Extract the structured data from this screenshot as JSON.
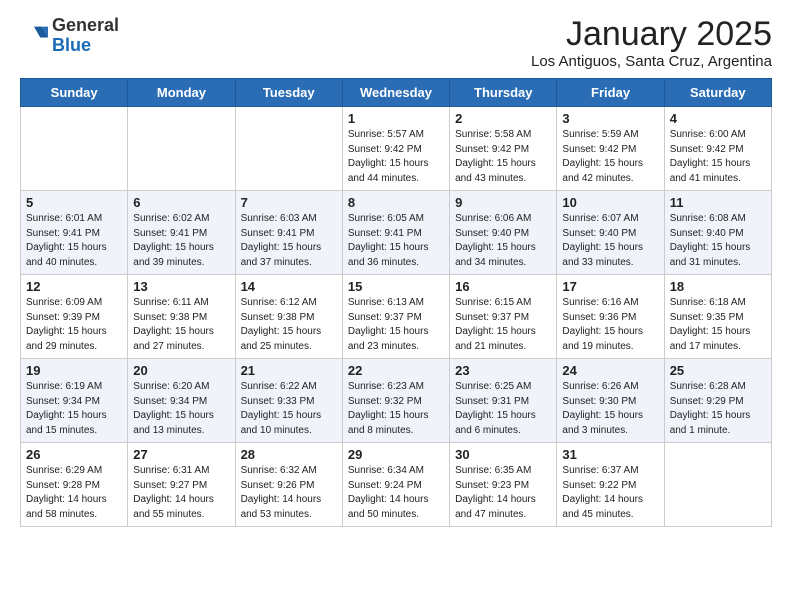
{
  "header": {
    "logo_general": "General",
    "logo_blue": "Blue",
    "month": "January 2025",
    "location": "Los Antiguos, Santa Cruz, Argentina"
  },
  "days_of_week": [
    "Sunday",
    "Monday",
    "Tuesday",
    "Wednesday",
    "Thursday",
    "Friday",
    "Saturday"
  ],
  "weeks": [
    [
      {
        "day": "",
        "info": ""
      },
      {
        "day": "",
        "info": ""
      },
      {
        "day": "",
        "info": ""
      },
      {
        "day": "1",
        "info": "Sunrise: 5:57 AM\nSunset: 9:42 PM\nDaylight: 15 hours\nand 44 minutes."
      },
      {
        "day": "2",
        "info": "Sunrise: 5:58 AM\nSunset: 9:42 PM\nDaylight: 15 hours\nand 43 minutes."
      },
      {
        "day": "3",
        "info": "Sunrise: 5:59 AM\nSunset: 9:42 PM\nDaylight: 15 hours\nand 42 minutes."
      },
      {
        "day": "4",
        "info": "Sunrise: 6:00 AM\nSunset: 9:42 PM\nDaylight: 15 hours\nand 41 minutes."
      }
    ],
    [
      {
        "day": "5",
        "info": "Sunrise: 6:01 AM\nSunset: 9:41 PM\nDaylight: 15 hours\nand 40 minutes."
      },
      {
        "day": "6",
        "info": "Sunrise: 6:02 AM\nSunset: 9:41 PM\nDaylight: 15 hours\nand 39 minutes."
      },
      {
        "day": "7",
        "info": "Sunrise: 6:03 AM\nSunset: 9:41 PM\nDaylight: 15 hours\nand 37 minutes."
      },
      {
        "day": "8",
        "info": "Sunrise: 6:05 AM\nSunset: 9:41 PM\nDaylight: 15 hours\nand 36 minutes."
      },
      {
        "day": "9",
        "info": "Sunrise: 6:06 AM\nSunset: 9:40 PM\nDaylight: 15 hours\nand 34 minutes."
      },
      {
        "day": "10",
        "info": "Sunrise: 6:07 AM\nSunset: 9:40 PM\nDaylight: 15 hours\nand 33 minutes."
      },
      {
        "day": "11",
        "info": "Sunrise: 6:08 AM\nSunset: 9:40 PM\nDaylight: 15 hours\nand 31 minutes."
      }
    ],
    [
      {
        "day": "12",
        "info": "Sunrise: 6:09 AM\nSunset: 9:39 PM\nDaylight: 15 hours\nand 29 minutes."
      },
      {
        "day": "13",
        "info": "Sunrise: 6:11 AM\nSunset: 9:38 PM\nDaylight: 15 hours\nand 27 minutes."
      },
      {
        "day": "14",
        "info": "Sunrise: 6:12 AM\nSunset: 9:38 PM\nDaylight: 15 hours\nand 25 minutes."
      },
      {
        "day": "15",
        "info": "Sunrise: 6:13 AM\nSunset: 9:37 PM\nDaylight: 15 hours\nand 23 minutes."
      },
      {
        "day": "16",
        "info": "Sunrise: 6:15 AM\nSunset: 9:37 PM\nDaylight: 15 hours\nand 21 minutes."
      },
      {
        "day": "17",
        "info": "Sunrise: 6:16 AM\nSunset: 9:36 PM\nDaylight: 15 hours\nand 19 minutes."
      },
      {
        "day": "18",
        "info": "Sunrise: 6:18 AM\nSunset: 9:35 PM\nDaylight: 15 hours\nand 17 minutes."
      }
    ],
    [
      {
        "day": "19",
        "info": "Sunrise: 6:19 AM\nSunset: 9:34 PM\nDaylight: 15 hours\nand 15 minutes."
      },
      {
        "day": "20",
        "info": "Sunrise: 6:20 AM\nSunset: 9:34 PM\nDaylight: 15 hours\nand 13 minutes."
      },
      {
        "day": "21",
        "info": "Sunrise: 6:22 AM\nSunset: 9:33 PM\nDaylight: 15 hours\nand 10 minutes."
      },
      {
        "day": "22",
        "info": "Sunrise: 6:23 AM\nSunset: 9:32 PM\nDaylight: 15 hours\nand 8 minutes."
      },
      {
        "day": "23",
        "info": "Sunrise: 6:25 AM\nSunset: 9:31 PM\nDaylight: 15 hours\nand 6 minutes."
      },
      {
        "day": "24",
        "info": "Sunrise: 6:26 AM\nSunset: 9:30 PM\nDaylight: 15 hours\nand 3 minutes."
      },
      {
        "day": "25",
        "info": "Sunrise: 6:28 AM\nSunset: 9:29 PM\nDaylight: 15 hours\nand 1 minute."
      }
    ],
    [
      {
        "day": "26",
        "info": "Sunrise: 6:29 AM\nSunset: 9:28 PM\nDaylight: 14 hours\nand 58 minutes."
      },
      {
        "day": "27",
        "info": "Sunrise: 6:31 AM\nSunset: 9:27 PM\nDaylight: 14 hours\nand 55 minutes."
      },
      {
        "day": "28",
        "info": "Sunrise: 6:32 AM\nSunset: 9:26 PM\nDaylight: 14 hours\nand 53 minutes."
      },
      {
        "day": "29",
        "info": "Sunrise: 6:34 AM\nSunset: 9:24 PM\nDaylight: 14 hours\nand 50 minutes."
      },
      {
        "day": "30",
        "info": "Sunrise: 6:35 AM\nSunset: 9:23 PM\nDaylight: 14 hours\nand 47 minutes."
      },
      {
        "day": "31",
        "info": "Sunrise: 6:37 AM\nSunset: 9:22 PM\nDaylight: 14 hours\nand 45 minutes."
      },
      {
        "day": "",
        "info": ""
      }
    ]
  ]
}
